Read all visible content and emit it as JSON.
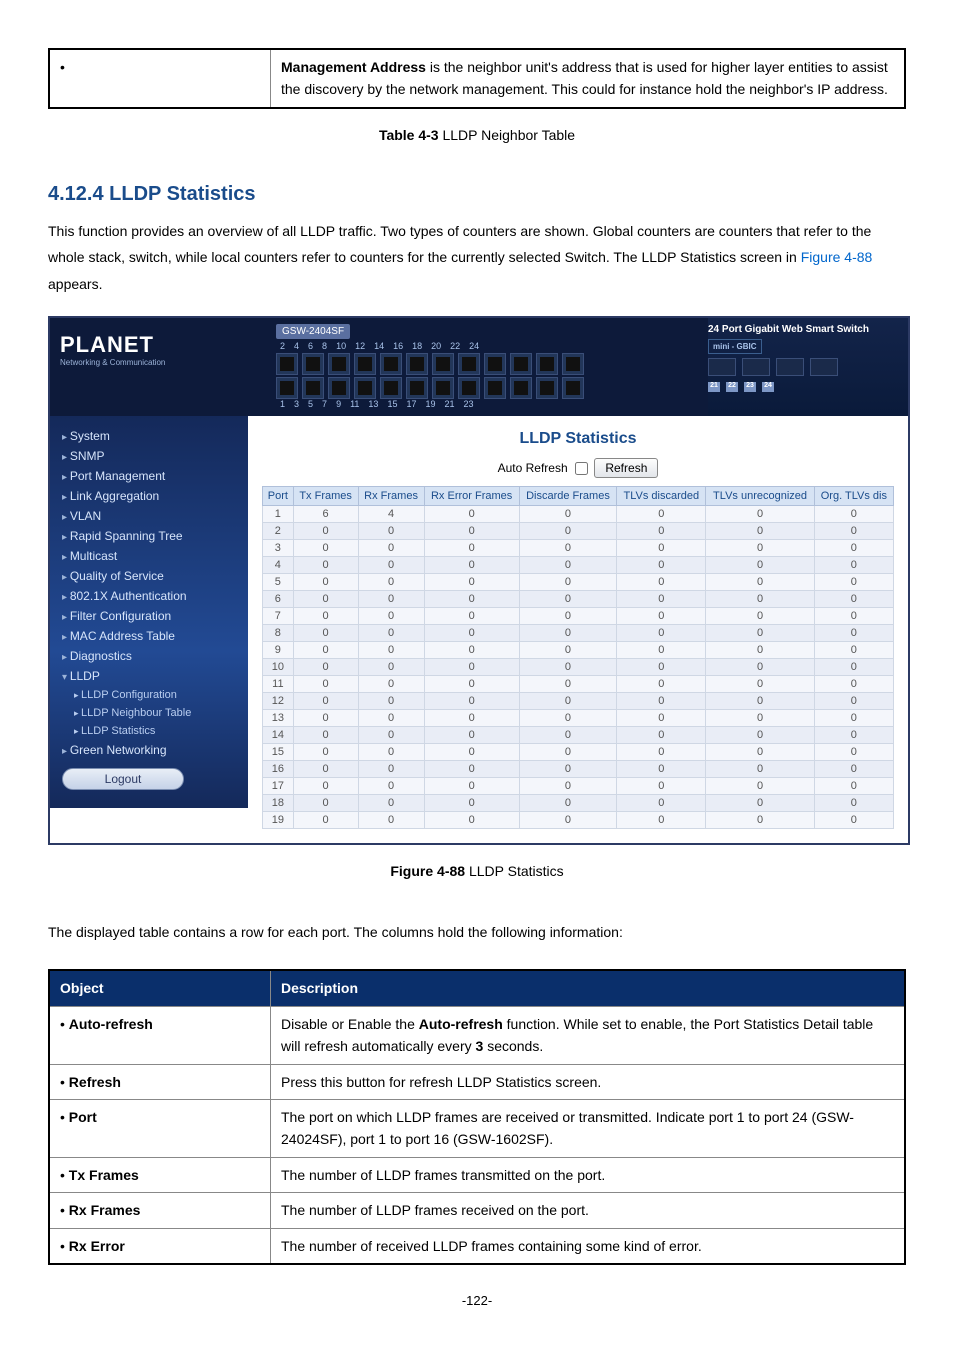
{
  "top_table": {
    "bullet": "•",
    "desc": "is the neighbor unit's address that is used for higher layer entities to assist the discovery by the network management. This could for instance hold the neighbor's IP address."
  },
  "caption1_prefix": "Table 4-3",
  "caption1_text": "LLDP Neighbor Table",
  "section_number": "4.12.4",
  "section_title": "LLDP Statistics",
  "para1_a": "This function provides an overview of all LLDP traffic. Two types of counters are shown. Global counters are counters that refer to the whole stack, switch, while local counters refer to counters for the currently selected Switch. The LLDP Statistics screen in ",
  "para1_link": "Figure 4-88",
  "para1_b": " appears.",
  "screenshot": {
    "model": "GSW-2404SF",
    "brand": "PLANET",
    "brand_sub": "Networking & Communication",
    "right_label": "24 Port Gigabit Web Smart Switch",
    "mini_gbic": "mini - GBIC",
    "even_ports": [
      "2",
      "4",
      "6",
      "8",
      "10",
      "12",
      "14",
      "16",
      "18",
      "20",
      "22",
      "24"
    ],
    "odd_ports": [
      "1",
      "3",
      "5",
      "7",
      "9",
      "11",
      "13",
      "15",
      "17",
      "19",
      "21",
      "23"
    ],
    "gbic_nums": [
      "21",
      "22",
      "23",
      "24"
    ],
    "sidebar": {
      "items": [
        "System",
        "SNMP",
        "Port Management",
        "Link Aggregation",
        "VLAN",
        "Rapid Spanning Tree",
        "Multicast",
        "Quality of Service",
        "802.1X Authentication",
        "Filter Configuration",
        "MAC Address Table",
        "Diagnostics"
      ],
      "lldp": "LLDP",
      "subs": [
        "LLDP Configuration",
        "LLDP Neighbour Table",
        "LLDP Statistics"
      ],
      "green": "Green Networking",
      "logout": "Logout"
    },
    "main": {
      "title": "LLDP Statistics",
      "auto_refresh": "Auto Refresh",
      "refresh": "Refresh",
      "headers": [
        "Port",
        "Tx Frames",
        "Rx Frames",
        "Rx Error Frames",
        "Discarde Frames",
        "TLVs discarded",
        "TLVs unrecognized",
        "Org. TLVs dis"
      ],
      "rows": [
        [
          "1",
          "6",
          "4",
          "0",
          "0",
          "0",
          "0",
          "0"
        ],
        [
          "2",
          "0",
          "0",
          "0",
          "0",
          "0",
          "0",
          "0"
        ],
        [
          "3",
          "0",
          "0",
          "0",
          "0",
          "0",
          "0",
          "0"
        ],
        [
          "4",
          "0",
          "0",
          "0",
          "0",
          "0",
          "0",
          "0"
        ],
        [
          "5",
          "0",
          "0",
          "0",
          "0",
          "0",
          "0",
          "0"
        ],
        [
          "6",
          "0",
          "0",
          "0",
          "0",
          "0",
          "0",
          "0"
        ],
        [
          "7",
          "0",
          "0",
          "0",
          "0",
          "0",
          "0",
          "0"
        ],
        [
          "8",
          "0",
          "0",
          "0",
          "0",
          "0",
          "0",
          "0"
        ],
        [
          "9",
          "0",
          "0",
          "0",
          "0",
          "0",
          "0",
          "0"
        ],
        [
          "10",
          "0",
          "0",
          "0",
          "0",
          "0",
          "0",
          "0"
        ],
        [
          "11",
          "0",
          "0",
          "0",
          "0",
          "0",
          "0",
          "0"
        ],
        [
          "12",
          "0",
          "0",
          "0",
          "0",
          "0",
          "0",
          "0"
        ],
        [
          "13",
          "0",
          "0",
          "0",
          "0",
          "0",
          "0",
          "0"
        ],
        [
          "14",
          "0",
          "0",
          "0",
          "0",
          "0",
          "0",
          "0"
        ],
        [
          "15",
          "0",
          "0",
          "0",
          "0",
          "0",
          "0",
          "0"
        ],
        [
          "16",
          "0",
          "0",
          "0",
          "0",
          "0",
          "0",
          "0"
        ],
        [
          "17",
          "0",
          "0",
          "0",
          "0",
          "0",
          "0",
          "0"
        ],
        [
          "18",
          "0",
          "0",
          "0",
          "0",
          "0",
          "0",
          "0"
        ],
        [
          "19",
          "0",
          "0",
          "0",
          "0",
          "0",
          "0",
          "0"
        ]
      ]
    }
  },
  "caption2_prefix": "Figure 4-88",
  "caption2_text": "LLDP Statistics",
  "para2": "The displayed table contains a row for each port. The columns hold the following information:",
  "desc_table": {
    "h1": "Object",
    "h2": "Description",
    "rows": [
      {
        "label": "Auto-refresh",
        "a": "Disable or Enable the ",
        "b": "Auto-refresh",
        "c": " function. While set to enable, the Port Statistics Detail table will refresh automatically every ",
        "d": "3",
        "e": " seconds."
      },
      {
        "label": "Refresh",
        "desc": "Press this button for refresh LLDP Statistics screen."
      },
      {
        "label": "Port",
        "desc": "The port on which LLDP frames are received or transmitted. Indicate port 1 to port 24 (GSW-24024SF), port 1 to port 16 (GSW-1602SF)."
      },
      {
        "label": "Tx Frames",
        "desc": "The number of LLDP frames transmitted on the port."
      },
      {
        "label": "Rx Frames",
        "desc": "The number of LLDP frames received on the port."
      },
      {
        "label": "Rx Error",
        "desc": "The number of received LLDP frames containing some kind of error."
      }
    ]
  },
  "page_num": "-122-"
}
